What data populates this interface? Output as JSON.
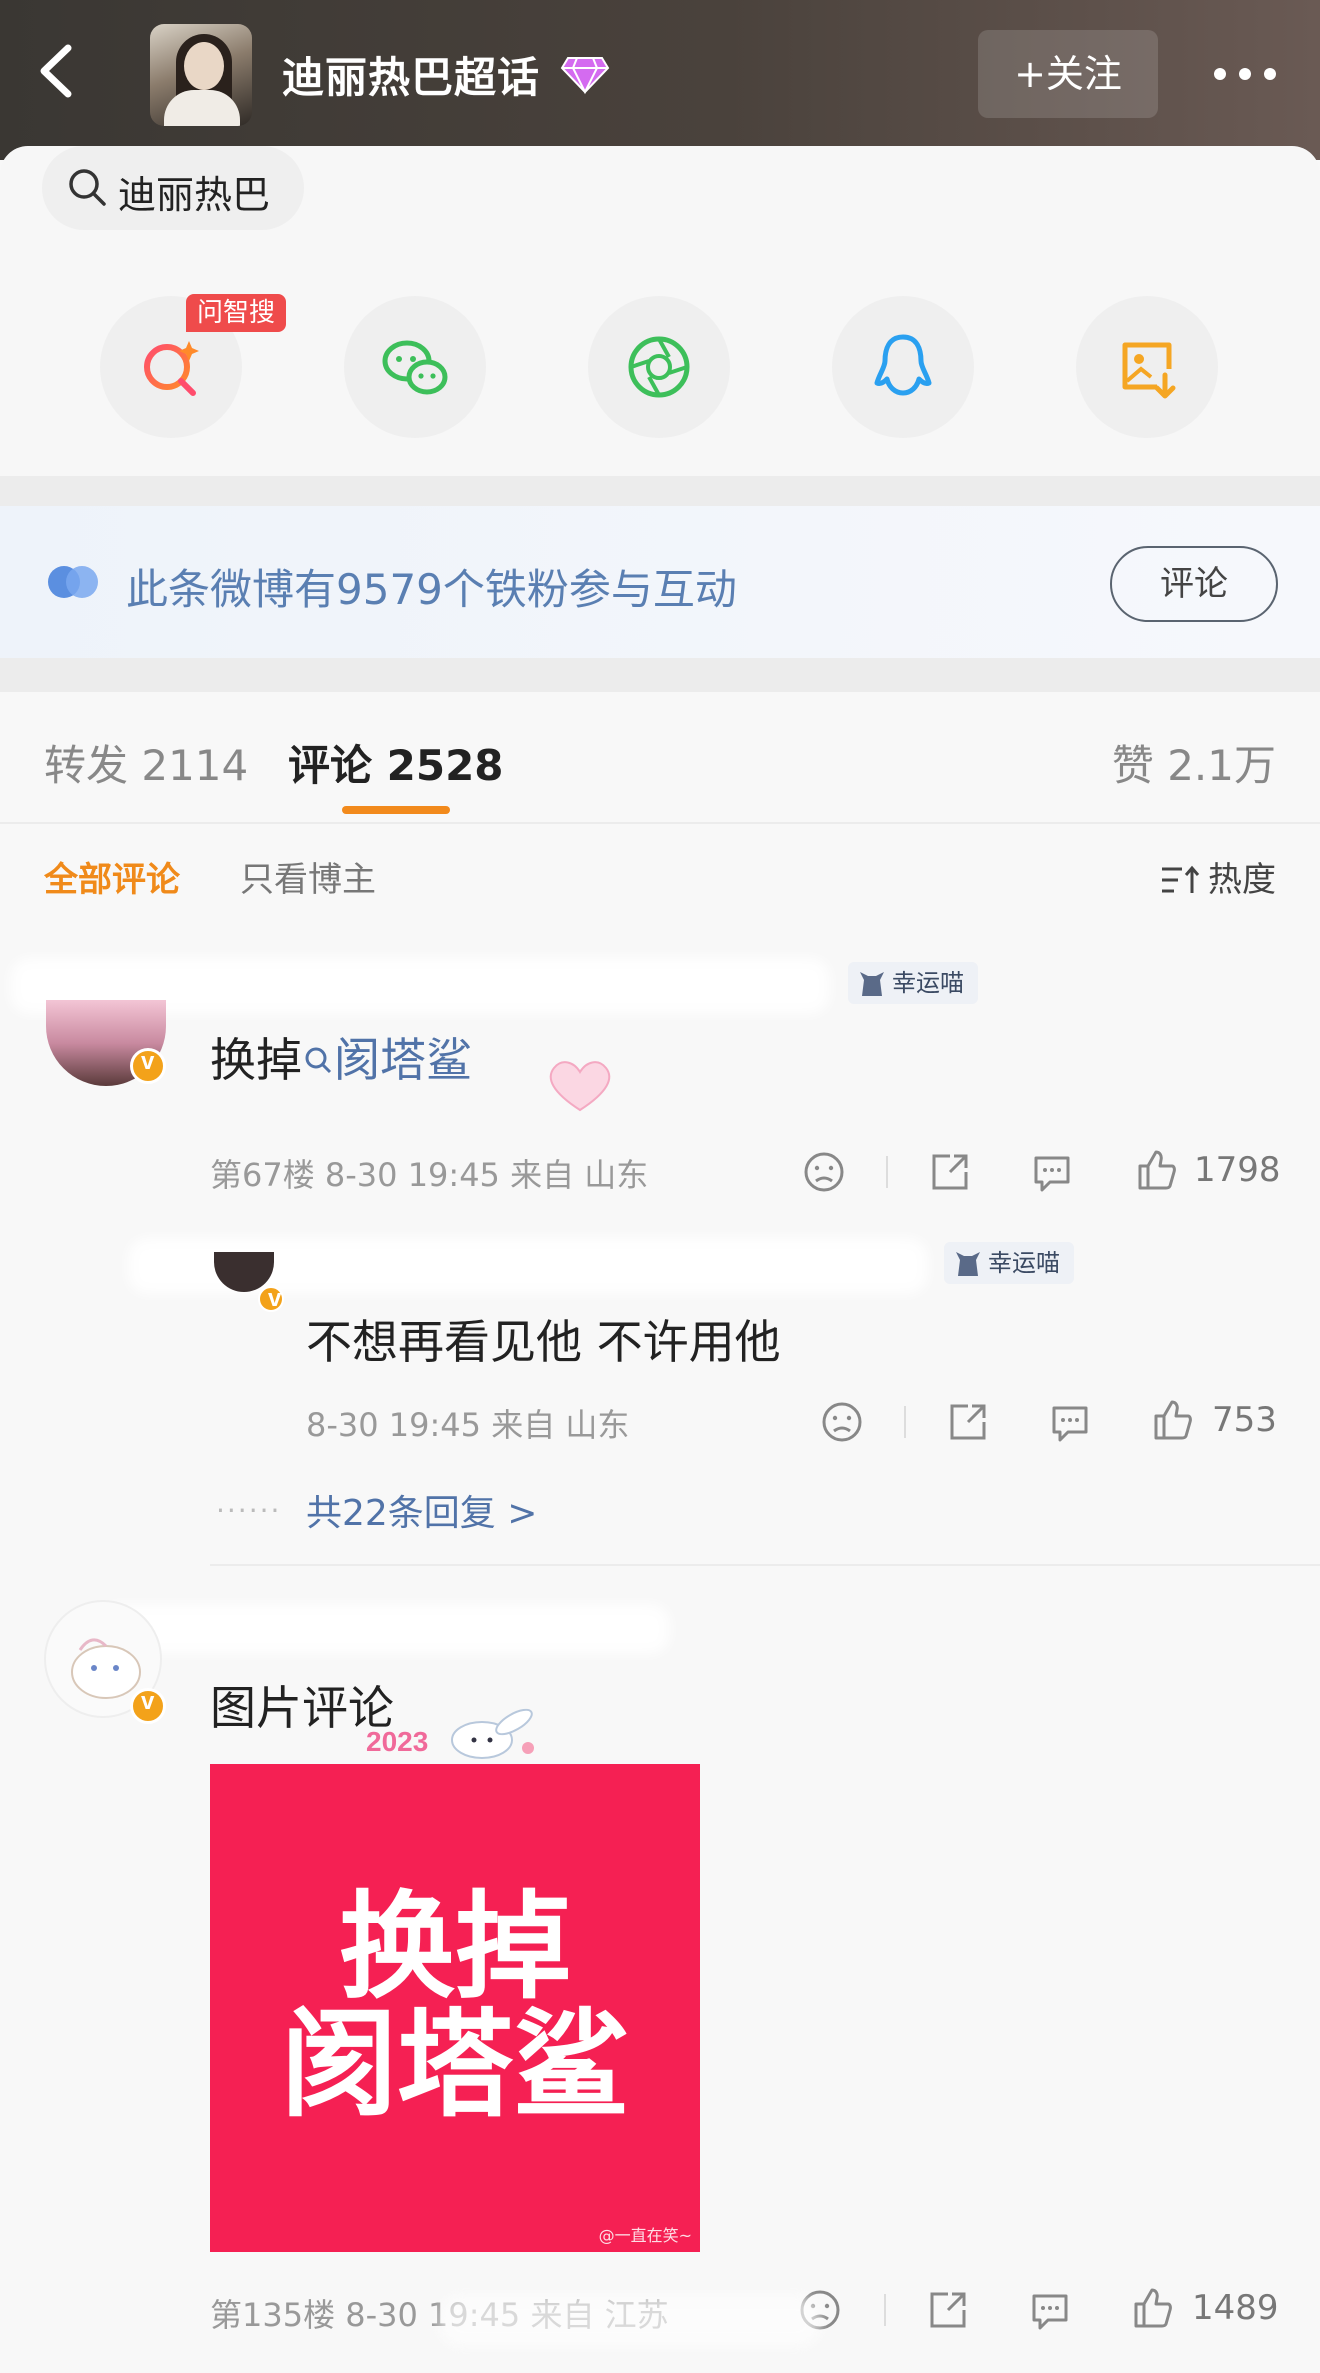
{
  "header": {
    "title": "迪丽热巴超话",
    "follow_label": "+关注"
  },
  "share_sheet": {
    "search_chip": "迪丽热巴",
    "badge": "问智搜",
    "icons": [
      "ai-search-icon",
      "wechat-icon",
      "moments-icon",
      "qq-icon",
      "save-image-icon"
    ]
  },
  "fan_banner": {
    "text": "此条微博有9579个铁粉参与互动",
    "button": "评论"
  },
  "tabs": {
    "repost": "转发 2114",
    "comments": "评论 2528",
    "likes": "赞 2.1万"
  },
  "filters": {
    "all": "全部评论",
    "owner_only": "只看博主",
    "sort": "热度"
  },
  "comments": [
    {
      "lucky": "幸运喵",
      "text_prefix": "换掉",
      "text_link": "阂塔鲨",
      "meta": "第67楼  8-30 19:45  来自 山东",
      "likes": "1798"
    },
    {
      "lucky": "幸运喵",
      "text": "不想再看见他 不许用他",
      "meta": "8-30 19:45  来自 山东",
      "likes": "753",
      "more_replies": "共22条回复 >",
      "dots": "......"
    },
    {
      "text": "图片评论",
      "sticker": "2023",
      "image_line1": "换掉",
      "image_line2": "阂塔鲨",
      "image_watermark": "@一直在笑~",
      "meta": "第135楼  8-30 19:45  来自 江苏",
      "likes": "1489"
    }
  ],
  "colors": {
    "accent": "#f08a1a",
    "link": "#5173a8",
    "image_bg": "#f52053"
  }
}
